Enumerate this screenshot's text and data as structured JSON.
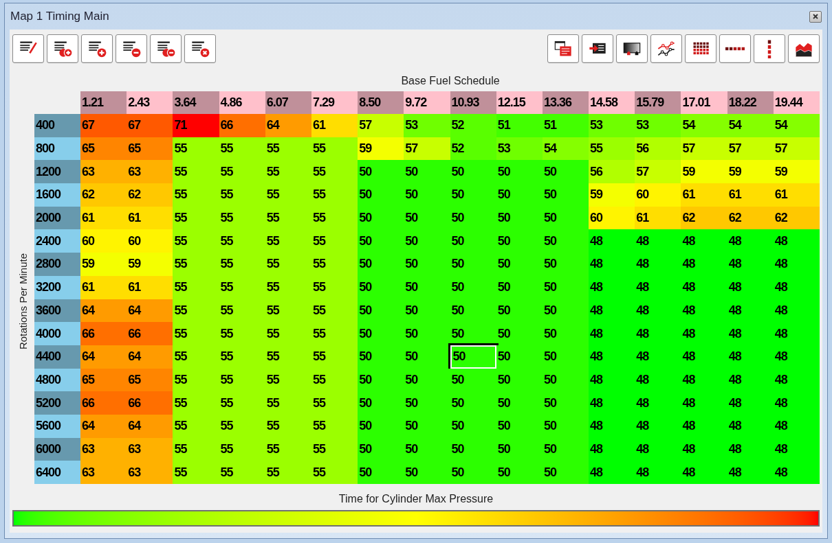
{
  "window": {
    "title": "Map 1 Timing Main"
  },
  "table": {
    "x_axis_title": "Base Fuel Schedule",
    "y_axis_title": "Rotations Per Minute",
    "legend_title": "Time for Cylinder Max Pressure",
    "columns": [
      "1.21",
      "2.43",
      "3.64",
      "4.86",
      "6.07",
      "7.29",
      "8.50",
      "9.72",
      "10.93",
      "12.15",
      "13.36",
      "14.58",
      "15.79",
      "17.01",
      "18.22",
      "19.44"
    ],
    "rows": [
      {
        "rpm": "400",
        "cells": [
          {
            "v": "67",
            "selected": false
          },
          {
            "v": "67",
            "selected": false
          },
          {
            "v": "71",
            "selected": false
          },
          {
            "v": "66",
            "selected": false
          },
          {
            "v": "64",
            "selected": false
          },
          {
            "v": "61",
            "selected": false
          },
          {
            "v": "57",
            "selected": false
          },
          {
            "v": "53",
            "selected": false
          },
          {
            "v": "52",
            "selected": false
          },
          {
            "v": "51",
            "selected": false
          },
          {
            "v": "51",
            "selected": false
          },
          {
            "v": "53",
            "selected": false
          },
          {
            "v": "53",
            "selected": false
          },
          {
            "v": "54",
            "selected": false
          },
          {
            "v": "54",
            "selected": false
          },
          {
            "v": "54",
            "selected": false
          }
        ]
      },
      {
        "rpm": "800",
        "cells": [
          {
            "v": "65",
            "selected": false
          },
          {
            "v": "65",
            "selected": false
          },
          {
            "v": "55",
            "selected": false
          },
          {
            "v": "55",
            "selected": false
          },
          {
            "v": "55",
            "selected": false
          },
          {
            "v": "55",
            "selected": false
          },
          {
            "v": "59",
            "selected": false
          },
          {
            "v": "57",
            "selected": false
          },
          {
            "v": "52",
            "selected": false
          },
          {
            "v": "53",
            "selected": false
          },
          {
            "v": "54",
            "selected": false
          },
          {
            "v": "55",
            "selected": false
          },
          {
            "v": "56",
            "selected": false
          },
          {
            "v": "57",
            "selected": false
          },
          {
            "v": "57",
            "selected": false
          },
          {
            "v": "57",
            "selected": false
          }
        ]
      },
      {
        "rpm": "1200",
        "cells": [
          {
            "v": "63",
            "selected": false
          },
          {
            "v": "63",
            "selected": false
          },
          {
            "v": "55",
            "selected": false
          },
          {
            "v": "55",
            "selected": false
          },
          {
            "v": "55",
            "selected": false
          },
          {
            "v": "55",
            "selected": false
          },
          {
            "v": "50",
            "selected": false
          },
          {
            "v": "50",
            "selected": false
          },
          {
            "v": "50",
            "selected": false
          },
          {
            "v": "50",
            "selected": false
          },
          {
            "v": "50",
            "selected": false
          },
          {
            "v": "56",
            "selected": false
          },
          {
            "v": "57",
            "selected": false
          },
          {
            "v": "59",
            "selected": false
          },
          {
            "v": "59",
            "selected": false
          },
          {
            "v": "59",
            "selected": false
          }
        ]
      },
      {
        "rpm": "1600",
        "cells": [
          {
            "v": "62",
            "selected": false
          },
          {
            "v": "62",
            "selected": false
          },
          {
            "v": "55",
            "selected": false
          },
          {
            "v": "55",
            "selected": false
          },
          {
            "v": "55",
            "selected": false
          },
          {
            "v": "55",
            "selected": false
          },
          {
            "v": "50",
            "selected": false
          },
          {
            "v": "50",
            "selected": false
          },
          {
            "v": "50",
            "selected": false
          },
          {
            "v": "50",
            "selected": false
          },
          {
            "v": "50",
            "selected": false
          },
          {
            "v": "59",
            "selected": false
          },
          {
            "v": "60",
            "selected": false
          },
          {
            "v": "61",
            "selected": false
          },
          {
            "v": "61",
            "selected": false
          },
          {
            "v": "61",
            "selected": false
          }
        ]
      },
      {
        "rpm": "2000",
        "cells": [
          {
            "v": "61",
            "selected": false
          },
          {
            "v": "61",
            "selected": false
          },
          {
            "v": "55",
            "selected": false
          },
          {
            "v": "55",
            "selected": false
          },
          {
            "v": "55",
            "selected": false
          },
          {
            "v": "55",
            "selected": false
          },
          {
            "v": "50",
            "selected": false
          },
          {
            "v": "50",
            "selected": false
          },
          {
            "v": "50",
            "selected": false
          },
          {
            "v": "50",
            "selected": false
          },
          {
            "v": "50",
            "selected": false
          },
          {
            "v": "60",
            "selected": false
          },
          {
            "v": "61",
            "selected": false
          },
          {
            "v": "62",
            "selected": false
          },
          {
            "v": "62",
            "selected": false
          },
          {
            "v": "62",
            "selected": false
          }
        ]
      },
      {
        "rpm": "2400",
        "cells": [
          {
            "v": "60",
            "selected": false
          },
          {
            "v": "60",
            "selected": false
          },
          {
            "v": "55",
            "selected": false
          },
          {
            "v": "55",
            "selected": false
          },
          {
            "v": "55",
            "selected": false
          },
          {
            "v": "55",
            "selected": false
          },
          {
            "v": "50",
            "selected": false
          },
          {
            "v": "50",
            "selected": false
          },
          {
            "v": "50",
            "selected": false
          },
          {
            "v": "50",
            "selected": false
          },
          {
            "v": "50",
            "selected": false
          },
          {
            "v": "48",
            "selected": false
          },
          {
            "v": "48",
            "selected": false
          },
          {
            "v": "48",
            "selected": false
          },
          {
            "v": "48",
            "selected": false
          },
          {
            "v": "48",
            "selected": false
          }
        ]
      },
      {
        "rpm": "2800",
        "cells": [
          {
            "v": "59",
            "selected": false
          },
          {
            "v": "59",
            "selected": false
          },
          {
            "v": "55",
            "selected": false
          },
          {
            "v": "55",
            "selected": false
          },
          {
            "v": "55",
            "selected": false
          },
          {
            "v": "55",
            "selected": false
          },
          {
            "v": "50",
            "selected": false
          },
          {
            "v": "50",
            "selected": false
          },
          {
            "v": "50",
            "selected": false
          },
          {
            "v": "50",
            "selected": false
          },
          {
            "v": "50",
            "selected": false
          },
          {
            "v": "48",
            "selected": false
          },
          {
            "v": "48",
            "selected": false
          },
          {
            "v": "48",
            "selected": false
          },
          {
            "v": "48",
            "selected": false
          },
          {
            "v": "48",
            "selected": false
          }
        ]
      },
      {
        "rpm": "3200",
        "cells": [
          {
            "v": "61",
            "selected": false
          },
          {
            "v": "61",
            "selected": false
          },
          {
            "v": "55",
            "selected": false
          },
          {
            "v": "55",
            "selected": false
          },
          {
            "v": "55",
            "selected": false
          },
          {
            "v": "55",
            "selected": false
          },
          {
            "v": "50",
            "selected": false
          },
          {
            "v": "50",
            "selected": false
          },
          {
            "v": "50",
            "selected": false
          },
          {
            "v": "50",
            "selected": false
          },
          {
            "v": "50",
            "selected": false
          },
          {
            "v": "48",
            "selected": false
          },
          {
            "v": "48",
            "selected": false
          },
          {
            "v": "48",
            "selected": false
          },
          {
            "v": "48",
            "selected": false
          },
          {
            "v": "48",
            "selected": false
          }
        ]
      },
      {
        "rpm": "3600",
        "cells": [
          {
            "v": "64",
            "selected": false
          },
          {
            "v": "64",
            "selected": false
          },
          {
            "v": "55",
            "selected": false
          },
          {
            "v": "55",
            "selected": false
          },
          {
            "v": "55",
            "selected": false
          },
          {
            "v": "55",
            "selected": false
          },
          {
            "v": "50",
            "selected": false
          },
          {
            "v": "50",
            "selected": false
          },
          {
            "v": "50",
            "selected": false
          },
          {
            "v": "50",
            "selected": false
          },
          {
            "v": "50",
            "selected": false
          },
          {
            "v": "48",
            "selected": false
          },
          {
            "v": "48",
            "selected": false
          },
          {
            "v": "48",
            "selected": false
          },
          {
            "v": "48",
            "selected": false
          },
          {
            "v": "48",
            "selected": false
          }
        ]
      },
      {
        "rpm": "4000",
        "cells": [
          {
            "v": "66",
            "selected": false
          },
          {
            "v": "66",
            "selected": false
          },
          {
            "v": "55",
            "selected": false
          },
          {
            "v": "55",
            "selected": false
          },
          {
            "v": "55",
            "selected": false
          },
          {
            "v": "55",
            "selected": false
          },
          {
            "v": "50",
            "selected": false
          },
          {
            "v": "50",
            "selected": false
          },
          {
            "v": "50",
            "selected": false
          },
          {
            "v": "50",
            "selected": false
          },
          {
            "v": "50",
            "selected": false
          },
          {
            "v": "48",
            "selected": false
          },
          {
            "v": "48",
            "selected": false
          },
          {
            "v": "48",
            "selected": false
          },
          {
            "v": "48",
            "selected": false
          },
          {
            "v": "48",
            "selected": false
          }
        ]
      },
      {
        "rpm": "4400",
        "cells": [
          {
            "v": "64",
            "selected": false
          },
          {
            "v": "64",
            "selected": false
          },
          {
            "v": "55",
            "selected": false
          },
          {
            "v": "55",
            "selected": false
          },
          {
            "v": "55",
            "selected": false
          },
          {
            "v": "55",
            "selected": false
          },
          {
            "v": "50",
            "selected": false
          },
          {
            "v": "50",
            "selected": false
          },
          {
            "v": "50",
            "selected": true
          },
          {
            "v": "50",
            "selected": false
          },
          {
            "v": "50",
            "selected": false
          },
          {
            "v": "48",
            "selected": false
          },
          {
            "v": "48",
            "selected": false
          },
          {
            "v": "48",
            "selected": false
          },
          {
            "v": "48",
            "selected": false
          },
          {
            "v": "48",
            "selected": false
          }
        ]
      },
      {
        "rpm": "4800",
        "cells": [
          {
            "v": "65",
            "selected": false
          },
          {
            "v": "65",
            "selected": false
          },
          {
            "v": "55",
            "selected": false
          },
          {
            "v": "55",
            "selected": false
          },
          {
            "v": "55",
            "selected": false
          },
          {
            "v": "55",
            "selected": false
          },
          {
            "v": "50",
            "selected": false
          },
          {
            "v": "50",
            "selected": false
          },
          {
            "v": "50",
            "selected": false
          },
          {
            "v": "50",
            "selected": false
          },
          {
            "v": "50",
            "selected": false
          },
          {
            "v": "48",
            "selected": false
          },
          {
            "v": "48",
            "selected": false
          },
          {
            "v": "48",
            "selected": false
          },
          {
            "v": "48",
            "selected": false
          },
          {
            "v": "48",
            "selected": false
          }
        ]
      },
      {
        "rpm": "5200",
        "cells": [
          {
            "v": "66",
            "selected": false
          },
          {
            "v": "66",
            "selected": false
          },
          {
            "v": "55",
            "selected": false
          },
          {
            "v": "55",
            "selected": false
          },
          {
            "v": "55",
            "selected": false
          },
          {
            "v": "55",
            "selected": false
          },
          {
            "v": "50",
            "selected": false
          },
          {
            "v": "50",
            "selected": false
          },
          {
            "v": "50",
            "selected": false
          },
          {
            "v": "50",
            "selected": false
          },
          {
            "v": "50",
            "selected": false
          },
          {
            "v": "48",
            "selected": false
          },
          {
            "v": "48",
            "selected": false
          },
          {
            "v": "48",
            "selected": false
          },
          {
            "v": "48",
            "selected": false
          },
          {
            "v": "48",
            "selected": false
          }
        ]
      },
      {
        "rpm": "5600",
        "cells": [
          {
            "v": "64",
            "selected": false
          },
          {
            "v": "64",
            "selected": false
          },
          {
            "v": "55",
            "selected": false
          },
          {
            "v": "55",
            "selected": false
          },
          {
            "v": "55",
            "selected": false
          },
          {
            "v": "55",
            "selected": false
          },
          {
            "v": "50",
            "selected": false
          },
          {
            "v": "50",
            "selected": false
          },
          {
            "v": "50",
            "selected": false
          },
          {
            "v": "50",
            "selected": false
          },
          {
            "v": "50",
            "selected": false
          },
          {
            "v": "48",
            "selected": false
          },
          {
            "v": "48",
            "selected": false
          },
          {
            "v": "48",
            "selected": false
          },
          {
            "v": "48",
            "selected": false
          },
          {
            "v": "48",
            "selected": false
          }
        ]
      },
      {
        "rpm": "6000",
        "cells": [
          {
            "v": "63",
            "selected": false
          },
          {
            "v": "63",
            "selected": false
          },
          {
            "v": "55",
            "selected": false
          },
          {
            "v": "55",
            "selected": false
          },
          {
            "v": "55",
            "selected": false
          },
          {
            "v": "55",
            "selected": false
          },
          {
            "v": "50",
            "selected": false
          },
          {
            "v": "50",
            "selected": false
          },
          {
            "v": "50",
            "selected": false
          },
          {
            "v": "50",
            "selected": false
          },
          {
            "v": "50",
            "selected": false
          },
          {
            "v": "48",
            "selected": false
          },
          {
            "v": "48",
            "selected": false
          },
          {
            "v": "48",
            "selected": false
          },
          {
            "v": "48",
            "selected": false
          },
          {
            "v": "48",
            "selected": false
          }
        ]
      },
      {
        "rpm": "6400",
        "cells": [
          {
            "v": "63",
            "selected": false
          },
          {
            "v": "63",
            "selected": false
          },
          {
            "v": "55",
            "selected": false
          },
          {
            "v": "55",
            "selected": false
          },
          {
            "v": "55",
            "selected": false
          },
          {
            "v": "55",
            "selected": false
          },
          {
            "v": "50",
            "selected": false
          },
          {
            "v": "50",
            "selected": false
          },
          {
            "v": "50",
            "selected": false
          },
          {
            "v": "50",
            "selected": false
          },
          {
            "v": "50",
            "selected": false
          },
          {
            "v": "48",
            "selected": false
          },
          {
            "v": "48",
            "selected": false
          },
          {
            "v": "48",
            "selected": false
          },
          {
            "v": "48",
            "selected": false
          },
          {
            "v": "48",
            "selected": false
          }
        ]
      }
    ]
  }
}
